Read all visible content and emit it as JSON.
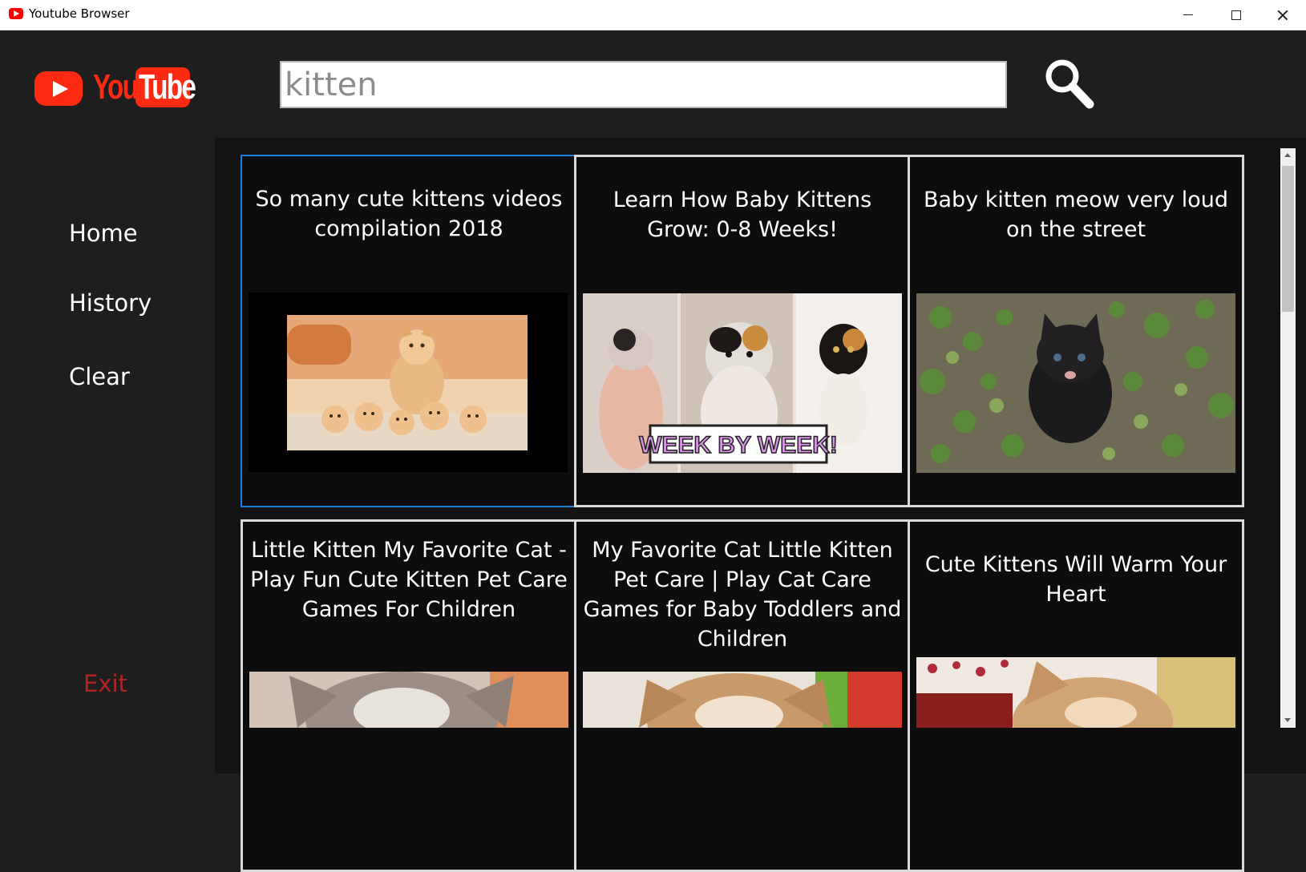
{
  "window": {
    "title": "Youtube Browser"
  },
  "logo": {
    "you": "You",
    "tube": "Tube"
  },
  "search": {
    "value": "kitten"
  },
  "sidebar": {
    "items": [
      {
        "label": "Home"
      },
      {
        "label": "History"
      },
      {
        "label": "Clear"
      }
    ],
    "exit_label": "Exit"
  },
  "results": [
    {
      "title": "So many cute kittens videos compilation 2018"
    },
    {
      "title": "Learn How Baby Kittens Grow: 0-8 Weeks!",
      "thumb_text": "WEEK BY WEEK!"
    },
    {
      "title": "Baby kitten meow very loud on the street"
    },
    {
      "title": "Little Kitten My Favorite Cat - Play Fun Cute Kitten Pet Care Games For Children"
    },
    {
      "title": "My Favorite Cat Little Kitten Pet Care | Play Cat Care Games for Baby Toddlers and Children"
    },
    {
      "title": "Cute Kittens Will Warm Your Heart"
    }
  ],
  "colors": {
    "brand_red": "#ff2a12",
    "exit_red": "#b22323",
    "selection_blue": "#1a7fe0"
  }
}
